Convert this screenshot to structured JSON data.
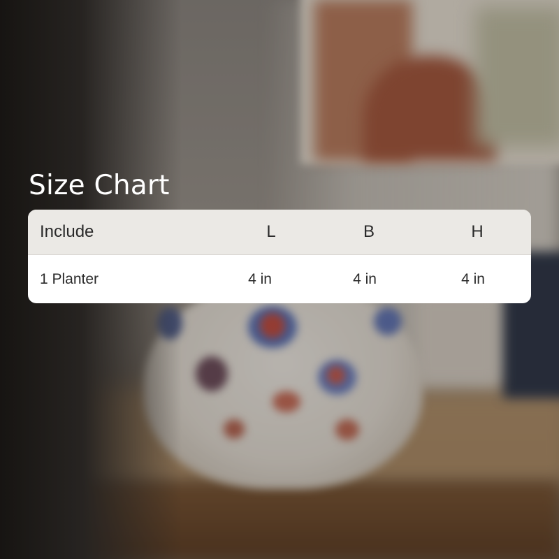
{
  "title": "Size Chart",
  "table": {
    "headers": [
      "Include",
      "L",
      "B",
      "H"
    ],
    "rows": [
      [
        "1 Planter",
        "4 in",
        "4 in",
        "4 in"
      ]
    ]
  },
  "colors": {
    "title_text": "#ffffff",
    "header_bg": "#ebe9e5",
    "body_bg": "#ffffff",
    "table_text": "#2a2a2a"
  }
}
